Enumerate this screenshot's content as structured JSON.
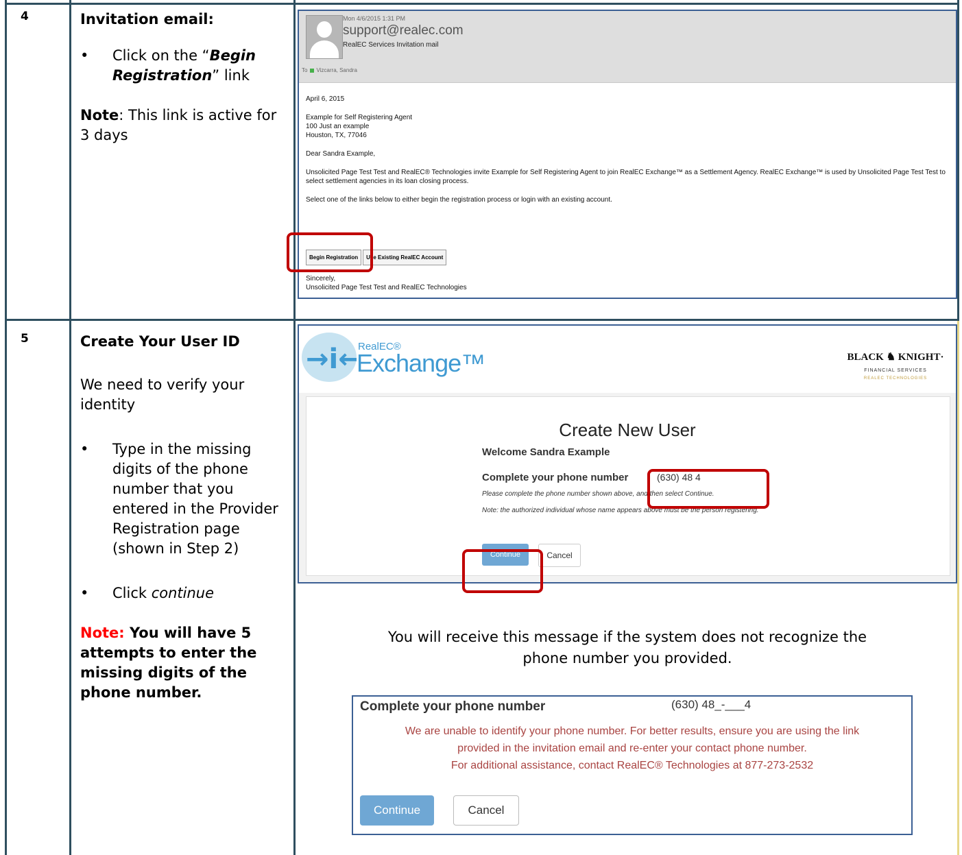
{
  "step4": {
    "number": "4",
    "title": "Invitation email:",
    "bullet_pre": "Click on the “",
    "bullet_link": "Begin Registration",
    "bullet_post": "” link",
    "note_label": "Note",
    "note_text": ": This link is active for 3 days",
    "email": {
      "date": "Mon 4/6/2015 1:31 PM",
      "from": "support@realec.com",
      "subject": "RealEC Services Invitation mail",
      "to_label": "To",
      "to_name": "Vizcarra, Sandra",
      "body_date": "April 6, 2015",
      "address1": "Example for Self Registering Agent",
      "address2": "100 Just an example",
      "address3": "Houston, TX, 77046",
      "greeting": "Dear Sandra Example,",
      "paragraph1": "Unsolicited Page Test Test and RealEC® Technologies invite Example for Self Registering Agent to join RealEC Exchange™ as a Settlement Agency. RealEC Exchange™ is used by Unsolicited Page Test Test to select settlement agencies in its loan closing process.",
      "paragraph2": "Select one of the links below to either begin the registration process or login with an existing account.",
      "btn_begin": "Begin Registration",
      "btn_existing": "Use Existing RealEC Account",
      "closing": "Sincerely,",
      "signature": "Unsolicited Page Test Test and RealEC Technologies"
    }
  },
  "step5": {
    "number": "5",
    "title": "Create Your User ID",
    "intro": "We need to verify your identity",
    "bullet1": "Type in the missing digits of the phone number that you entered in the Provider Registration page (shown in Step 2)",
    "bullet2_pre": "Click ",
    "bullet2_em": "continue",
    "note_label": "Note:",
    "note_text": " You will have 5 attempts to enter the missing digits of the phone number.",
    "exchange": {
      "brand_small": "RealEC®",
      "brand_large": "Exchange™",
      "bk_name_left": "BLACK",
      "bk_name_right": "KNIGHT·",
      "bk_line1": "FINANCIAL SERVICES",
      "bk_line2": "REALEC TECHNOLOGIES",
      "heading": "Create New User",
      "welcome": "Welcome Sandra Example",
      "phone_label": "Complete your phone number",
      "phone_value": "(630) 48        4",
      "hint1": "Please complete the phone number shown above, and then select Continue.",
      "hint2": "Note: the authorized individual whose name appears above must be the person registering.",
      "continue": "Continue",
      "cancel": "Cancel"
    },
    "caption_line1": "You will receive this message if the system does not recognize the",
    "caption_line2": "phone number you provided.",
    "error": {
      "phone_label": "Complete your phone number",
      "phone_value": "(630) 48_-___4",
      "line1": "We are unable to identify your phone number. For better results, ensure you are using the link",
      "line2": "provided in the invitation email and re-enter your contact phone number.",
      "line3": "For additional assistance, contact RealEC® Technologies at 877-273-2532",
      "continue": "Continue",
      "cancel": "Cancel"
    }
  },
  "colors": {
    "grid": "#2f4f5f",
    "highlight": "#c00000",
    "note_red": "#ff0000",
    "error_text": "#a94442",
    "button_blue": "#6fa7d4"
  }
}
